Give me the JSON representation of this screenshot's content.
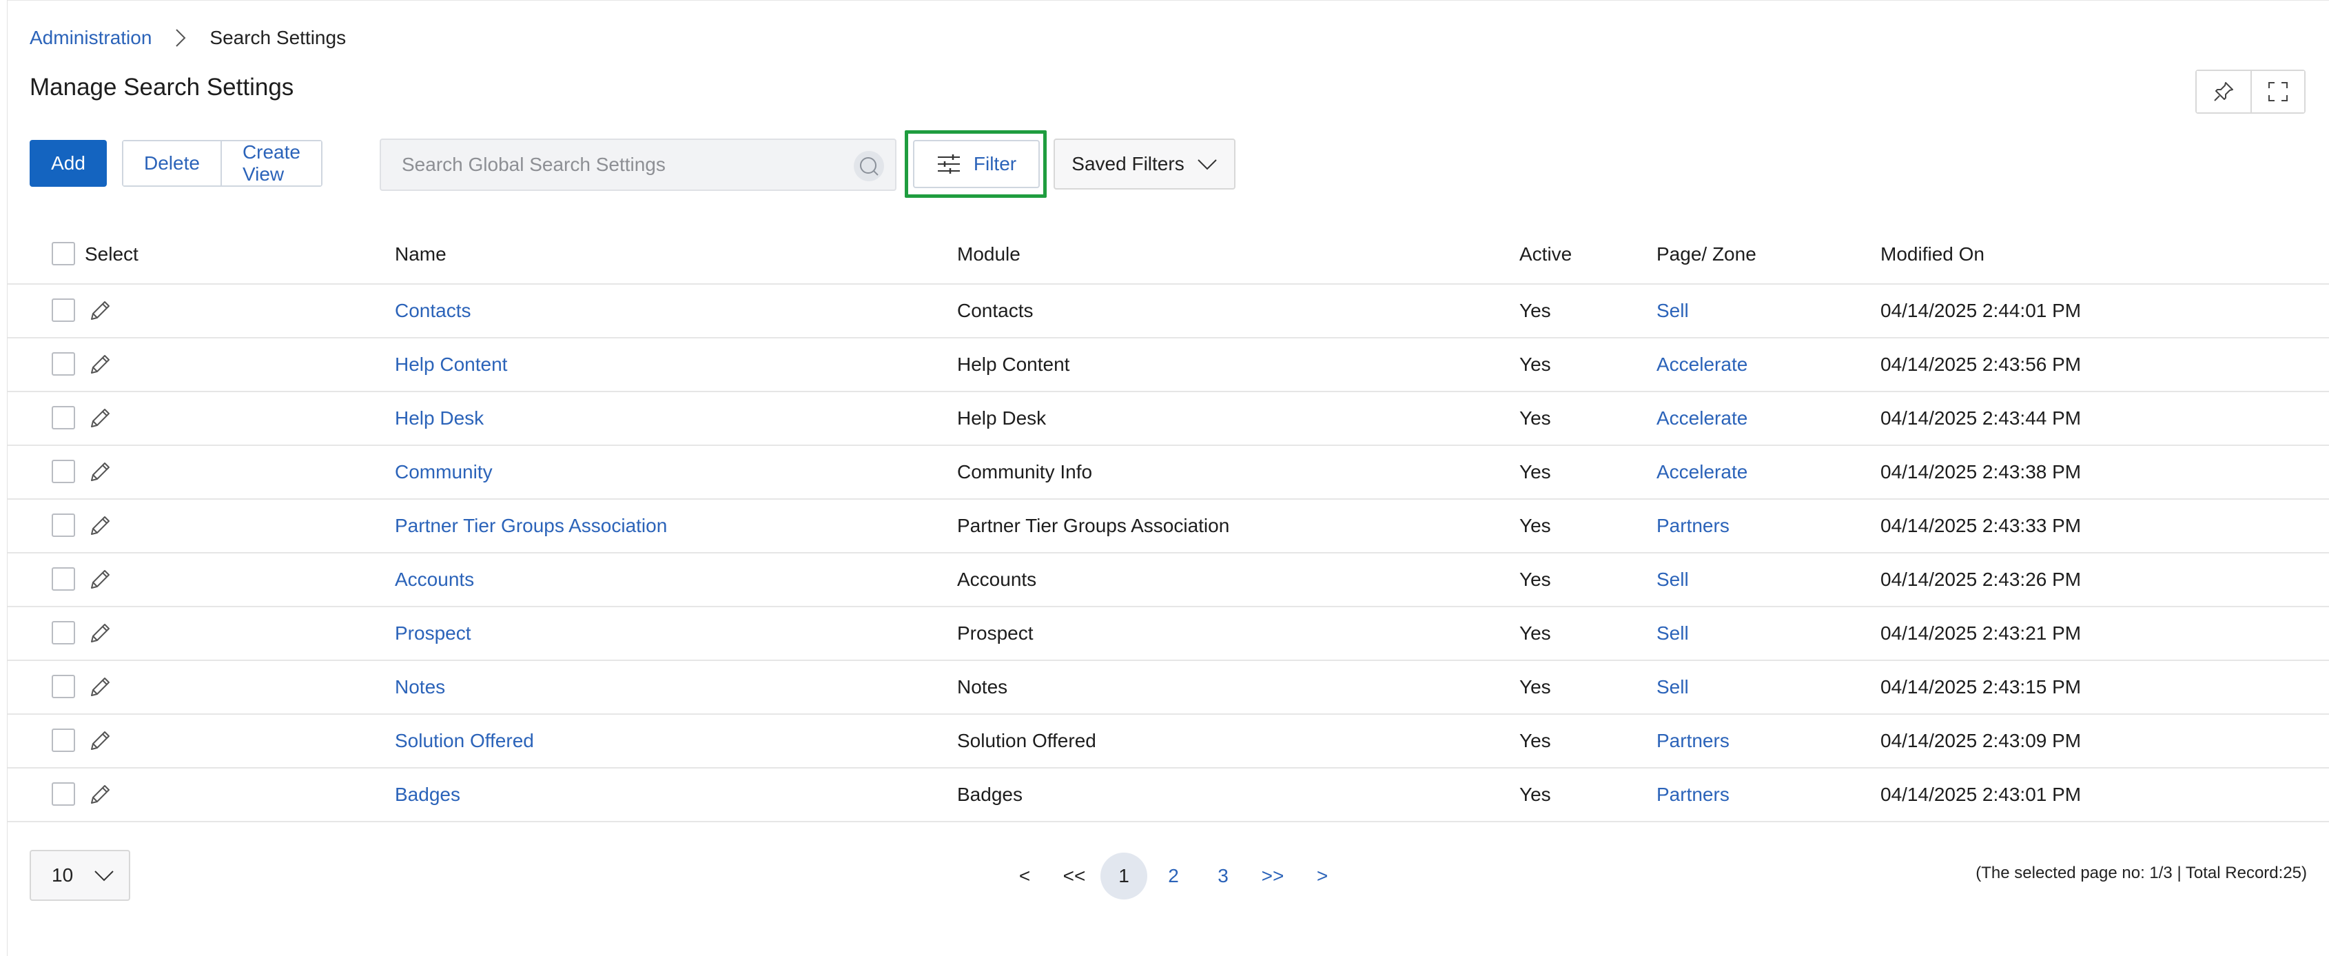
{
  "breadcrumb": {
    "parent": "Administration",
    "current": "Search Settings"
  },
  "page": {
    "title": "Manage Search Settings"
  },
  "toolbar": {
    "add_label": "Add",
    "delete_label": "Delete",
    "create_view_label": "Create View",
    "search_placeholder": "Search Global Search Settings",
    "filter_label": "Filter",
    "saved_filters_label": "Saved Filters"
  },
  "table": {
    "columns": {
      "select": "Select",
      "name": "Name",
      "module": "Module",
      "active": "Active",
      "zone": "Page/ Zone",
      "modified": "Modified On"
    },
    "rows": [
      {
        "name": "Contacts",
        "module": "Contacts",
        "active": "Yes",
        "zone": "Sell",
        "modified": "04/14/2025 2:44:01 PM"
      },
      {
        "name": "Help Content",
        "module": "Help Content",
        "active": "Yes",
        "zone": "Accelerate",
        "modified": "04/14/2025 2:43:56 PM"
      },
      {
        "name": "Help Desk",
        "module": "Help Desk",
        "active": "Yes",
        "zone": "Accelerate",
        "modified": "04/14/2025 2:43:44 PM"
      },
      {
        "name": "Community",
        "module": "Community Info",
        "active": "Yes",
        "zone": "Accelerate",
        "modified": "04/14/2025 2:43:38 PM"
      },
      {
        "name": "Partner Tier Groups Association",
        "module": "Partner Tier Groups Association",
        "active": "Yes",
        "zone": "Partners",
        "modified": "04/14/2025 2:43:33 PM"
      },
      {
        "name": "Accounts",
        "module": "Accounts",
        "active": "Yes",
        "zone": "Sell",
        "modified": "04/14/2025 2:43:26 PM"
      },
      {
        "name": "Prospect",
        "module": "Prospect",
        "active": "Yes",
        "zone": "Sell",
        "modified": "04/14/2025 2:43:21 PM"
      },
      {
        "name": "Notes",
        "module": "Notes",
        "active": "Yes",
        "zone": "Sell",
        "modified": "04/14/2025 2:43:15 PM"
      },
      {
        "name": "Solution Offered",
        "module": "Solution Offered",
        "active": "Yes",
        "zone": "Partners",
        "modified": "04/14/2025 2:43:09 PM"
      },
      {
        "name": "Badges",
        "module": "Badges",
        "active": "Yes",
        "zone": "Partners",
        "modified": "04/14/2025 2:43:01 PM"
      }
    ]
  },
  "pagination": {
    "page_size": "10",
    "prev": "<",
    "first": "<<",
    "pages": [
      "1",
      "2",
      "3"
    ],
    "last": ">>",
    "next": ">",
    "info": "(The selected page no: 1/3 | Total Record:25)"
  },
  "icons": {
    "breadcrumb_sep": "chevron-right-icon",
    "pin": "pin-icon",
    "fullscreen": "fullscreen-icon",
    "search": "search-icon",
    "filter": "sliders-icon",
    "dropdown": "chevron-down-icon",
    "edit": "pencil-icon"
  },
  "colors": {
    "primary": "#1464c0",
    "link": "#2b63b9",
    "highlight": "#1f9d3f"
  }
}
